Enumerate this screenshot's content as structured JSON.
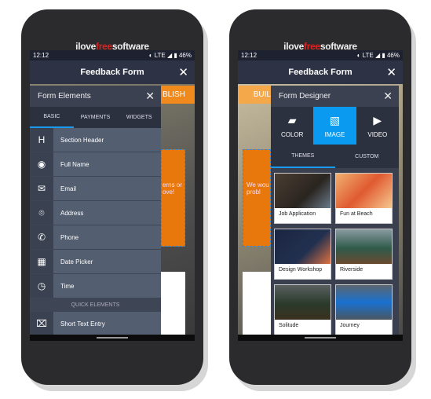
{
  "brand": {
    "pre": "ilove",
    "mid": "free",
    "post": "software"
  },
  "status": {
    "time": "12:12",
    "signal": "◐ LTE ◢",
    "battery": "▮ 46%"
  },
  "header": {
    "title": "Feedback Form",
    "close": "✕"
  },
  "left": {
    "behind_bar": "BLISH",
    "behind_text": "erns or ove!",
    "drawer_title": "Form Elements",
    "tabs": [
      "BASIC",
      "PAYMENTS",
      "WIDGETS"
    ],
    "items": [
      {
        "icon": "heading-icon",
        "glyph": "H",
        "label": "Section Header"
      },
      {
        "icon": "user-icon",
        "glyph": "◉",
        "label": "Full Name"
      },
      {
        "icon": "envelope-icon",
        "glyph": "✉",
        "label": "Email"
      },
      {
        "icon": "location-pin-icon",
        "glyph": "⌾",
        "label": "Address"
      },
      {
        "icon": "phone-icon",
        "glyph": "✆",
        "label": "Phone"
      },
      {
        "icon": "calendar-icon",
        "glyph": "▦",
        "label": "Date Picker"
      },
      {
        "icon": "clock-icon",
        "glyph": "◷",
        "label": "Time"
      }
    ],
    "quick_header": "QUICK ELEMENTS",
    "quick_items": [
      {
        "icon": "text-entry-icon",
        "glyph": "⌧",
        "label": "Short Text Entry"
      }
    ]
  },
  "right": {
    "behind_bar": "BUIL",
    "behind_text": "We wou probl",
    "drawer_title": "Form Designer",
    "design_tabs": [
      {
        "icon": "palette-icon",
        "glyph": "▰",
        "label": "COLOR"
      },
      {
        "icon": "image-icon",
        "glyph": "▧",
        "label": "IMAGE"
      },
      {
        "icon": "video-icon",
        "glyph": "▶",
        "label": "VIDEO"
      }
    ],
    "active_design_tab": "IMAGE",
    "sub_tabs": [
      "THEMES",
      "CUSTOM"
    ],
    "themes": [
      {
        "name": "Job Application",
        "bg": "linear-gradient(135deg,#4a3d32,#2a2520 60%,#6a7a8a)"
      },
      {
        "name": "Fun at Beach",
        "bg": "linear-gradient(135deg,#f0b070,#e05a30 50%,#f5c890)"
      },
      {
        "name": "Design Workshop",
        "bg": "linear-gradient(135deg,#1a2540,#223050 60%,#e07040)"
      },
      {
        "name": "Riverside",
        "bg": "linear-gradient(180deg,#8a9aa0,#2f5a4a 55%,#6a4a30)"
      },
      {
        "name": "Solitude",
        "bg": "linear-gradient(180deg,#5a6060,#2a3a2a 55%,#3a3020)"
      },
      {
        "name": "Journey",
        "bg": "linear-gradient(180deg,#5a6670,#1a70d0 50%,#4a5660)"
      }
    ]
  },
  "colors": {
    "accent": "#0a9af0",
    "orange": "#f08a1c"
  }
}
